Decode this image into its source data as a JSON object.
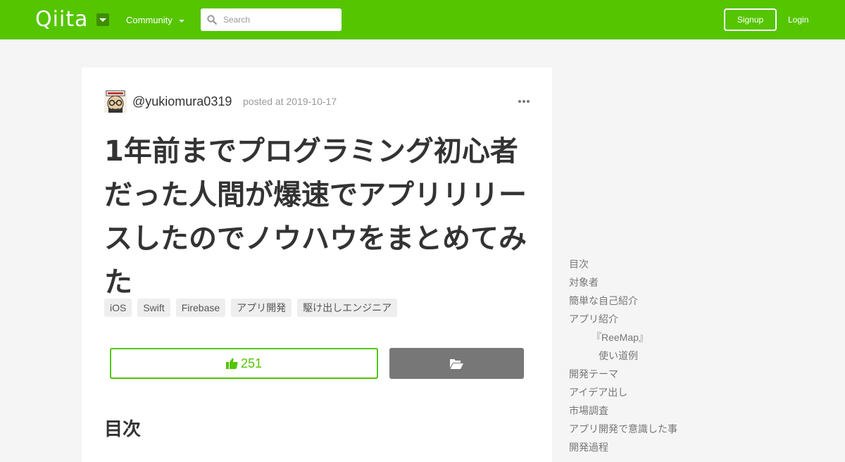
{
  "header": {
    "logo_text": "Qiita",
    "community_label": "Community",
    "search_placeholder": "Search",
    "signup_label": "Signup",
    "login_label": "Login",
    "brand_color": "#55c500"
  },
  "article": {
    "author": "@yukiomura0319",
    "posted": "posted at 2019-10-17",
    "title": "1年前までプログラミング初心者だった人間が爆速でアプリリリースしたのでノウハウをまとめてみた",
    "tags": [
      "iOS",
      "Swift",
      "Firebase",
      "アプリ開発",
      "駆け出しエンジニア"
    ],
    "like_count": "251",
    "toc_heading": "目次"
  },
  "toc": [
    {
      "label": "目次",
      "level": 1
    },
    {
      "label": "対象者",
      "level": 1
    },
    {
      "label": "簡単な自己紹介",
      "level": 1
    },
    {
      "label": "アプリ紹介",
      "level": 1
    },
    {
      "label": "『ReeMap』",
      "level": 2
    },
    {
      "label": "使い道例",
      "level": 3
    },
    {
      "label": "開発テーマ",
      "level": 1
    },
    {
      "label": "アイデア出し",
      "level": 1
    },
    {
      "label": "市場調査",
      "level": 1
    },
    {
      "label": "アプリ開発で意識した事",
      "level": 1
    },
    {
      "label": "開発過程",
      "level": 1
    }
  ]
}
